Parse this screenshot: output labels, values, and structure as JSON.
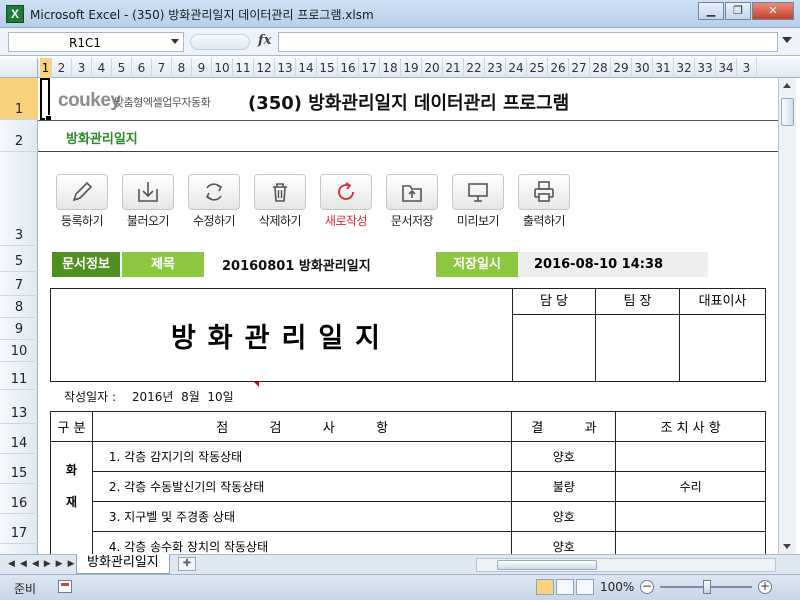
{
  "window": {
    "title": "Microsoft Excel - (350) 방화관리일지 데이터관리 프로그램.xlsm",
    "app_icon": "X"
  },
  "formula": {
    "namebox": "R1C1",
    "fx": "fx",
    "content": ""
  },
  "columns": [
    "1",
    "2",
    "3",
    "4",
    "5",
    "6",
    "7",
    "8",
    "9",
    "10",
    "11",
    "12",
    "13",
    "14",
    "15",
    "16",
    "17",
    "18",
    "19",
    "20",
    "21",
    "22",
    "23",
    "24",
    "25",
    "26",
    "27",
    "28",
    "29",
    "30",
    "31",
    "32",
    "33",
    "34",
    "3"
  ],
  "rows": [
    "1",
    "2",
    "3",
    "5",
    "7",
    "8",
    "9",
    "10",
    "11",
    "13",
    "14",
    "15",
    "16",
    "17"
  ],
  "header": {
    "logo": "coukey",
    "logo_sub": "맞춤형엑셀업무자동화",
    "title": "(350) 방화관리일지 데이터관리 프로그램",
    "sheet_tag": "방화관리일지"
  },
  "toolbar": {
    "register": "등록하기",
    "load": "불러오기",
    "edit": "수정하기",
    "delete": "삭제하기",
    "new": "새로작성",
    "save_doc": "문서저장",
    "preview": "미리보기",
    "print": "출력하기"
  },
  "info": {
    "doc_info_label": "문서정보",
    "subject_label": "제목",
    "subject_value": "20160801 방화관리일지",
    "saved_label": "저장일시",
    "saved_value": "2016-08-10 14:38"
  },
  "document": {
    "title": "방화관리일지",
    "approvals": [
      "담 당",
      "팀 장",
      "대표이사"
    ],
    "author_label": "작성일자 :",
    "author_date": "2016년  8월  10일",
    "table_headers": {
      "category": "구 분",
      "inspection": "점          검          사          항",
      "result": "결          과",
      "action": "조 치 사 항"
    },
    "category_label": "화\n재",
    "items": [
      {
        "text": "1. 각층 감지기의 작동상태",
        "result": "양호",
        "action": ""
      },
      {
        "text": "2. 각층 수동발신기의 작동상태",
        "result": "불량",
        "action": "수리"
      },
      {
        "text": "3. 지구벨 및 주경종 상태",
        "result": "양호",
        "action": ""
      },
      {
        "text": "4. 각층 송수화 장치의 작동상태",
        "result": "양호",
        "action": ""
      }
    ]
  },
  "tabs": {
    "sheet_name": "방화관리일지"
  },
  "status": {
    "ready": "준비",
    "zoom": "100%"
  },
  "colors": {
    "accent_dark_green": "#4e8f1f",
    "accent_light_green": "#8dc63f",
    "alert_red": "#d8282f"
  }
}
